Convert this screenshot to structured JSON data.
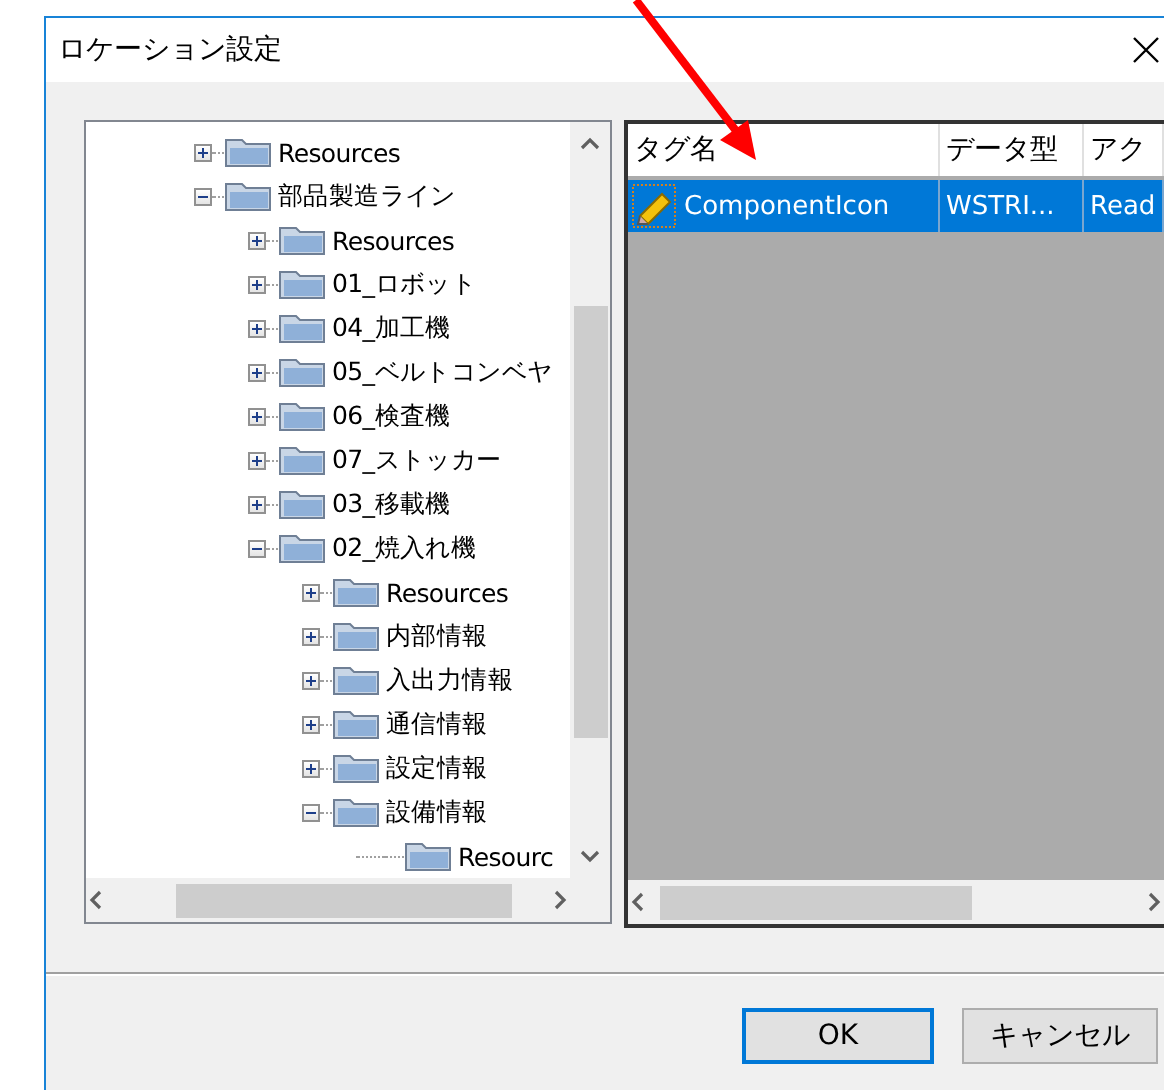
{
  "window": {
    "title": "ロケーション設定"
  },
  "tree": [
    {
      "label": "Resources",
      "expanded": false
    },
    {
      "label": "部品製造ライン",
      "expanded": true,
      "children": [
        {
          "label": "Resources",
          "expanded": false
        },
        {
          "label": "01_ロボット",
          "expanded": false
        },
        {
          "label": "04_加工機",
          "expanded": false
        },
        {
          "label": "05_ベルトコンベヤ",
          "expanded": false
        },
        {
          "label": "06_検査機",
          "expanded": false
        },
        {
          "label": "07_ストッカー",
          "expanded": false
        },
        {
          "label": "03_移載機",
          "expanded": false
        },
        {
          "label": "02_焼入れ機",
          "expanded": true,
          "children": [
            {
              "label": "Resources",
              "expanded": false
            },
            {
              "label": "内部情報",
              "expanded": false
            },
            {
              "label": "入出力情報",
              "expanded": false
            },
            {
              "label": "通信情報",
              "expanded": false
            },
            {
              "label": "設定情報",
              "expanded": false
            },
            {
              "label": "設備情報",
              "expanded": true,
              "children": [
                {
                  "label": "Resourc"
                }
              ]
            }
          ]
        }
      ]
    }
  ],
  "table": {
    "columns": [
      "タグ名",
      "データ型",
      "アク"
    ],
    "rows": [
      {
        "cells": [
          "ComponentIcon",
          "WSTRI...",
          "Read"
        ],
        "selected": true
      }
    ]
  },
  "buttons": [
    {
      "label": "OK",
      "default": true
    },
    {
      "label": "キャンセル",
      "default": false
    }
  ]
}
